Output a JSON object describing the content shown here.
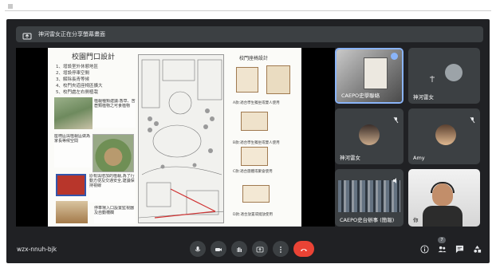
{
  "banner": {
    "text": "神河雷女正在分享螢幕畫面"
  },
  "slide": {
    "title": "校園門口設計",
    "list": [
      "1、增設室外休憩地區",
      "2、增設停車空間",
      "3、解除長青等候",
      "4、校門夾道座椅區擴大",
      "5、校門處左右側植栽"
    ],
    "note1": "植栽種類建議:香草、苦苣類植物之可食植物",
    "note2": "座椅區與植栽區做為家長等候空間",
    "note3": "原有與增加的植栽,為了行動方便及交通安全,建議保持視線",
    "note4": "停車場入口設置監視器及自動柵欄",
    "right_title": "校門座椅設計",
    "caption_a": "A款:適合學生獨坐或雙人使用",
    "caption_b": "B款:適合學生獨坐或雙人使用",
    "caption_c": "C款:適合團體或聚會使用",
    "caption_d": "D款:適合放置或擺放使用"
  },
  "participants": [
    {
      "name": "CAEPO史學聯絡",
      "muted": false
    },
    {
      "name": "神河雷女",
      "muted": false
    },
    {
      "name": "神河雷女",
      "muted": true
    },
    {
      "name": "Amy",
      "muted": true
    },
    {
      "name": "CAEPO史台辦事 (簡報)",
      "muted": false
    },
    {
      "name": "你",
      "muted": false
    }
  ],
  "meeting_code": "wzx-nnuh-bjk",
  "badge_count": "7",
  "colors": {
    "background": "#202124",
    "tile": "#3c4043",
    "end_call": "#ea4335",
    "accent": "#8ab4f8"
  },
  "icons": [
    "share-screen-icon",
    "mic-icon",
    "camera-icon",
    "raise-hand-icon",
    "present-icon",
    "more-options-icon",
    "end-call-icon",
    "info-icon",
    "people-icon",
    "chat-icon",
    "activities-icon"
  ]
}
